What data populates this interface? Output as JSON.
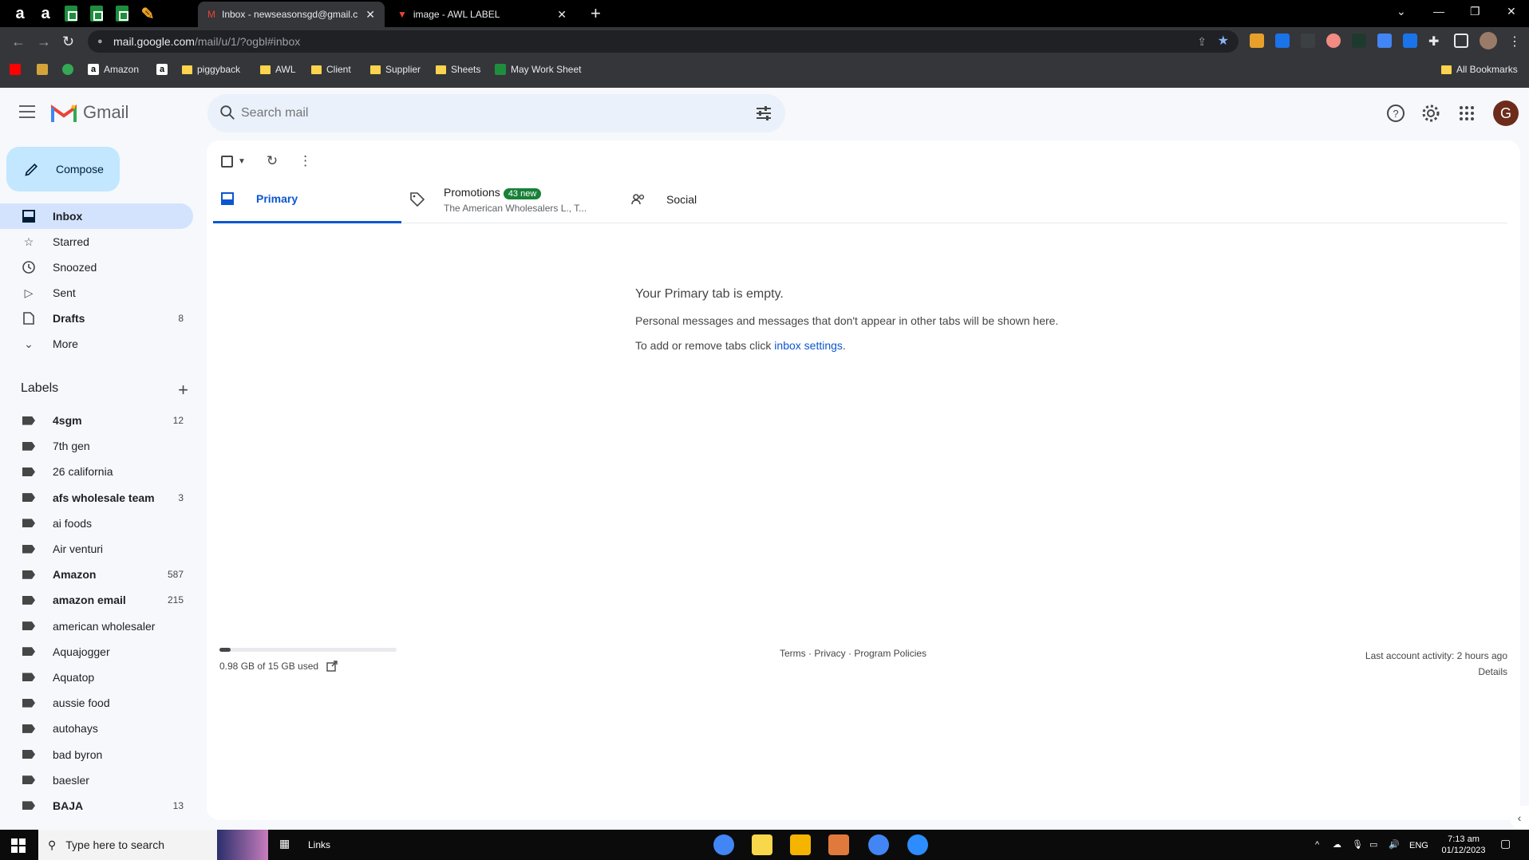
{
  "browser": {
    "tabs": [
      {
        "title": "Inbox - newseasonsgd@gmail.c",
        "active": true
      },
      {
        "title": "image - AWL LABEL",
        "active": false
      }
    ],
    "url_host": "mail.google.com",
    "url_path": "/mail/u/1/?ogbl#inbox",
    "bookmarks": [
      "Amazon",
      "piggyback",
      "AWL",
      "Client",
      "Supplier",
      "Sheets",
      "May Work Sheet"
    ],
    "all_bookmarks": "All Bookmarks"
  },
  "gmail": {
    "logo_text": "Gmail",
    "search_placeholder": "Search mail",
    "avatar_letter": "G",
    "compose_label": "Compose",
    "nav": [
      {
        "label": "Inbox",
        "count": "",
        "icon": "inbox-icon"
      },
      {
        "label": "Starred",
        "count": "",
        "icon": "star-icon"
      },
      {
        "label": "Snoozed",
        "count": "",
        "icon": "clock-icon"
      },
      {
        "label": "Sent",
        "count": "",
        "icon": "send-icon"
      },
      {
        "label": "Drafts",
        "count": "8",
        "icon": "draft-icon"
      },
      {
        "label": "More",
        "count": "",
        "icon": "chevron-down-icon"
      }
    ],
    "labels_title": "Labels",
    "labels": [
      {
        "name": "4sgm",
        "count": "12",
        "bold": true
      },
      {
        "name": "7th gen",
        "count": "",
        "bold": false
      },
      {
        "name": "26 california",
        "count": "",
        "bold": false
      },
      {
        "name": "afs wholesale team",
        "count": "3",
        "bold": true
      },
      {
        "name": "ai foods",
        "count": "",
        "bold": false
      },
      {
        "name": "Air venturi",
        "count": "",
        "bold": false
      },
      {
        "name": "Amazon",
        "count": "587",
        "bold": true
      },
      {
        "name": "amazon email",
        "count": "215",
        "bold": true
      },
      {
        "name": "american wholesaler",
        "count": "",
        "bold": false
      },
      {
        "name": "Aquajogger",
        "count": "",
        "bold": false
      },
      {
        "name": "Aquatop",
        "count": "",
        "bold": false
      },
      {
        "name": "aussie food",
        "count": "",
        "bold": false
      },
      {
        "name": "autohays",
        "count": "",
        "bold": false
      },
      {
        "name": "bad byron",
        "count": "",
        "bold": false
      },
      {
        "name": "baesler",
        "count": "",
        "bold": false
      },
      {
        "name": "BAJA",
        "count": "13",
        "bold": true
      }
    ],
    "tabs": {
      "primary": "Primary",
      "promotions": "Promotions",
      "promotions_badge": "43 new",
      "promotions_sub": "The American Wholesalers L., T...",
      "social": "Social"
    },
    "empty": {
      "heading": "Your Primary tab is empty.",
      "line1": "Personal messages and messages that don't appear in other tabs will be shown here.",
      "line2_prefix": "To add or remove tabs click ",
      "line2_link": "inbox settings",
      "line2_suffix": "."
    },
    "footer": {
      "storage": "0.98 GB of 15 GB used",
      "storage_fraction": 0.065,
      "links": "Terms · Privacy · Program Policies",
      "activity": "Last account activity: 2 hours ago",
      "details": "Details"
    }
  },
  "taskbar": {
    "search_placeholder": "Type here to search",
    "links_label": "Links",
    "lang": "ENG",
    "time": "7:13 am",
    "date": "01/12/2023"
  }
}
